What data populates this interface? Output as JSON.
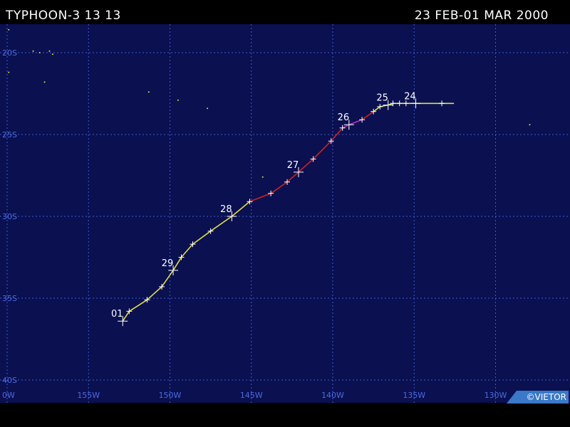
{
  "header": {
    "title": "TYPHOON-3 13 13",
    "date_range": "23 FEB-01 MAR 2000"
  },
  "credit": "©VIETOR",
  "map": {
    "ocean_color": "#0a1050",
    "grid_color": "#3a5bd0",
    "label_color": "#4c6ce0",
    "lon_ticks": [
      {
        "label": "0W",
        "lon": -160
      },
      {
        "label": "155W",
        "lon": -155
      },
      {
        "label": "150W",
        "lon": -150
      },
      {
        "label": "145W",
        "lon": -145
      },
      {
        "label": "140W",
        "lon": -140
      },
      {
        "label": "135W",
        "lon": -135
      },
      {
        "label": "130W",
        "lon": -130
      }
    ],
    "lat_ticks": [
      {
        "label": "20S",
        "lat": -20
      },
      {
        "label": "25S",
        "lat": -25
      },
      {
        "label": "30S",
        "lat": -30
      },
      {
        "label": "35S",
        "lat": -35
      },
      {
        "label": "40S",
        "lat": -40
      }
    ],
    "track": [
      {
        "lon": -133.3,
        "lat": -23.1,
        "color": "#e0e040"
      },
      {
        "lon": -134.9,
        "lat": -23.1,
        "color": "#e0e040",
        "day": "24"
      },
      {
        "lon": -135.5,
        "lat": -23.1,
        "color": "#e0e040"
      },
      {
        "lon": -135.9,
        "lat": -23.1,
        "color": "#e0e040"
      },
      {
        "lon": -136.3,
        "lat": -23.1,
        "color": "#e0e040"
      },
      {
        "lon": -136.6,
        "lat": -23.2,
        "color": "#e0e040",
        "day": "25"
      },
      {
        "lon": -137.1,
        "lat": -23.3,
        "color": "#e0e040"
      },
      {
        "lon": -137.5,
        "lat": -23.6,
        "color": "#e0e040"
      },
      {
        "lon": -138.2,
        "lat": -24.1,
        "color": "#d02020"
      },
      {
        "lon": -139.0,
        "lat": -24.4,
        "color": "#c030c0",
        "day": "26"
      },
      {
        "lon": -139.4,
        "lat": -24.6,
        "color": "#c030c0"
      },
      {
        "lon": -140.1,
        "lat": -25.4,
        "color": "#d02020"
      },
      {
        "lon": -141.2,
        "lat": -26.5,
        "color": "#d02020"
      },
      {
        "lon": -142.1,
        "lat": -27.3,
        "color": "#d02020",
        "day": "27"
      },
      {
        "lon": -142.8,
        "lat": -27.9,
        "color": "#d02020"
      },
      {
        "lon": -143.8,
        "lat": -28.6,
        "color": "#d02020"
      },
      {
        "lon": -145.1,
        "lat": -29.1,
        "color": "#d02020"
      },
      {
        "lon": -146.2,
        "lat": -30.0,
        "color": "#e0e040",
        "day": "28"
      },
      {
        "lon": -147.5,
        "lat": -30.9,
        "color": "#e0e040"
      },
      {
        "lon": -148.6,
        "lat": -31.7,
        "color": "#e0e040"
      },
      {
        "lon": -149.3,
        "lat": -32.5,
        "color": "#e0e040"
      },
      {
        "lon": -149.8,
        "lat": -33.3,
        "color": "#e0e040",
        "day": "29"
      },
      {
        "lon": -150.5,
        "lat": -34.3,
        "color": "#e0e040"
      },
      {
        "lon": -151.4,
        "lat": -35.1,
        "color": "#e0e040"
      },
      {
        "lon": -152.5,
        "lat": -35.8,
        "color": "#e0e040"
      },
      {
        "lon": -152.9,
        "lat": -36.4,
        "color": "#e0e040",
        "day": "01"
      }
    ],
    "islands": [
      {
        "lon": -159.9,
        "lat": -18.6
      },
      {
        "lon": -158.4,
        "lat": -19.9
      },
      {
        "lon": -158.0,
        "lat": -20.0
      },
      {
        "lon": -157.4,
        "lat": -19.9
      },
      {
        "lon": -157.2,
        "lat": -20.1
      },
      {
        "lon": -159.9,
        "lat": -21.2
      },
      {
        "lon": -157.7,
        "lat": -21.8
      },
      {
        "lon": -151.3,
        "lat": -22.4
      },
      {
        "lon": -149.5,
        "lat": -22.9
      },
      {
        "lon": -147.7,
        "lat": -23.4
      },
      {
        "lon": -144.3,
        "lat": -27.6
      },
      {
        "lon": -140.6,
        "lat": -17.9
      },
      {
        "lon": -127.9,
        "lat": -24.4
      }
    ]
  }
}
